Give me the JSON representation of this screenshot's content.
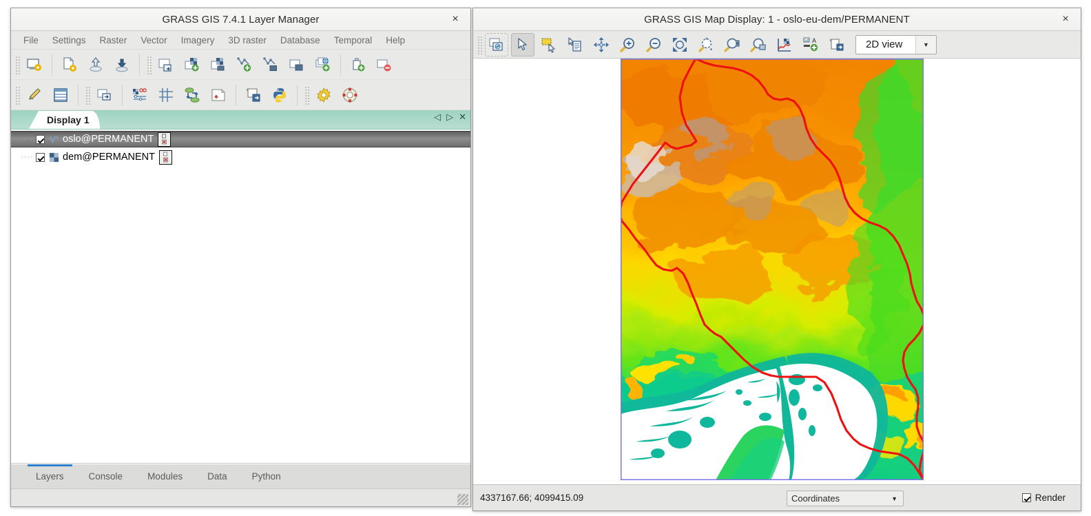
{
  "layer_manager": {
    "title": "GRASS GIS 7.4.1 Layer Manager",
    "close_label": "×",
    "menus": [
      "File",
      "Settings",
      "Raster",
      "Vector",
      "Imagery",
      "3D raster",
      "Database",
      "Temporal",
      "Help"
    ],
    "toolbar_row1": [
      {
        "name": "start-new-workspace-icon",
        "title": "Workspace"
      },
      {
        "name": "new-map-display-icon",
        "title": "New map display"
      },
      {
        "name": "load-workspace-icon",
        "title": "Load workspace"
      },
      {
        "name": "save-workspace-icon",
        "title": "Save workspace"
      },
      {
        "name": "import-raster-icon",
        "title": "Import raster"
      },
      {
        "name": "add-raster-layer-icon",
        "title": "Add raster map layer"
      },
      {
        "name": "add-raster-group-icon",
        "title": "Add various raster map layers"
      },
      {
        "name": "add-vector-layer-icon",
        "title": "Add vector map layer"
      },
      {
        "name": "add-vector-group-icon",
        "title": "Add various vector map layers"
      },
      {
        "name": "add-group-icon",
        "title": "Add group"
      },
      {
        "name": "add-web-service-icon",
        "title": "Add web service layer"
      },
      {
        "name": "add-command-layer-icon",
        "title": "Add command layer"
      },
      {
        "name": "remove-layer-icon",
        "title": "Remove selected layer"
      }
    ],
    "toolbar_row2": [
      {
        "name": "edit-vector-icon",
        "title": "Edit vector map"
      },
      {
        "name": "attribute-table-icon",
        "title": "Show attribute table"
      },
      {
        "name": "raster-digitizer-icon",
        "title": "Raster digitizer"
      },
      {
        "name": "georectifier-icon",
        "title": "Georectifier"
      },
      {
        "name": "map-swipe-icon",
        "title": "Map swipe"
      },
      {
        "name": "animation-icon",
        "title": "Animation tool"
      },
      {
        "name": "cartographic-composer-icon",
        "title": "Cartographic composer"
      },
      {
        "name": "script-icon",
        "title": "Launch script"
      },
      {
        "name": "python-shell-icon",
        "title": "Python shell"
      },
      {
        "name": "settings-gear-icon",
        "title": "GUI settings"
      },
      {
        "name": "help-icon",
        "title": "GRASS manual"
      }
    ],
    "display_tab": {
      "label": "Display 1",
      "nav_prev": "◁",
      "nav_next": "▷",
      "nav_close": "✕"
    },
    "layers": [
      {
        "name": "oslo@PERMANENT",
        "type": "vector",
        "checked": true,
        "selected": true
      },
      {
        "name": "dem@PERMANENT",
        "type": "raster",
        "checked": true,
        "selected": false
      }
    ],
    "bottom_tabs": [
      {
        "label": "Layers",
        "active": true
      },
      {
        "label": "Console",
        "active": false
      },
      {
        "label": "Modules",
        "active": false
      },
      {
        "label": "Data",
        "active": false
      },
      {
        "label": "Python",
        "active": false
      }
    ]
  },
  "map_display": {
    "title": "GRASS GIS Map Display: 1 - oslo-eu-dem/PERMANENT",
    "close_label": "×",
    "toolbar": [
      {
        "name": "render-map-icon",
        "title": "Re-render map",
        "pressed": false
      },
      {
        "name": "pointer-icon",
        "title": "Pointer",
        "pressed": true
      },
      {
        "name": "select-features-icon",
        "title": "Select features",
        "pressed": false
      },
      {
        "name": "query-raster-vector-icon",
        "title": "Query raster/vector map(s)",
        "pressed": false
      },
      {
        "name": "pan-icon",
        "title": "Pan",
        "pressed": false
      },
      {
        "name": "zoom-in-icon",
        "title": "Zoom in",
        "pressed": false
      },
      {
        "name": "zoom-out-icon",
        "title": "Zoom out",
        "pressed": false
      },
      {
        "name": "zoom-to-extent-icon",
        "title": "Zoom to selected map layer(s)",
        "pressed": false
      },
      {
        "name": "zoom-to-computational-region-icon",
        "title": "Zoom to computational region extent",
        "pressed": false
      },
      {
        "name": "zoom-back-icon",
        "title": "Return to previous zoom",
        "pressed": false
      },
      {
        "name": "zoom-options-icon",
        "title": "Various zoom options",
        "pressed": false
      },
      {
        "name": "analyze-map-icon",
        "title": "Analyze map",
        "pressed": false
      },
      {
        "name": "add-map-elements-icon",
        "title": "Add map elements",
        "pressed": false
      },
      {
        "name": "save-display-to-file-icon",
        "title": "Save display to file",
        "pressed": false
      }
    ],
    "view_mode": {
      "selected": "2D view",
      "arrow": "▼"
    },
    "statusbar": {
      "coordinates": "4337167.66; 4099415.09",
      "mode_selected": "Coordinates",
      "mode_arrow": "▼",
      "render_label": "Render",
      "render_checked": true
    },
    "map": {
      "raster_layer": "dem@PERMANENT",
      "vector_layer": "oslo@PERMANENT",
      "vector_color": "#ee1111",
      "region_border_color": "#7b76e8",
      "nodata_color": "#ffffff",
      "colors_low_to_high": [
        "#00a878",
        "#13c86e",
        "#48e01c",
        "#b8f000",
        "#ffe600",
        "#ffa600",
        "#f07800",
        "#b09080",
        "#e8e0dc"
      ]
    }
  }
}
